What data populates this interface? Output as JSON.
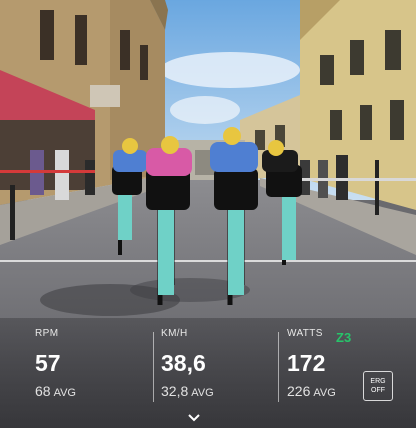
{
  "metrics": {
    "rpm": {
      "label": "RPM",
      "value": "57",
      "avg_value": "68",
      "avg_label": "AVG"
    },
    "speed": {
      "label": "KM/H",
      "value": "38,6",
      "avg_value": "32,8",
      "avg_label": "AVG"
    },
    "power": {
      "label": "WATTS",
      "zone": "Z3",
      "value": "172",
      "avg_value": "226",
      "avg_label": "AVG"
    }
  },
  "erg_toggle": {
    "line1": "ERG",
    "line2": "OFF"
  },
  "colors": {
    "zone": "#27c46a",
    "jersey_blue": "#4f7fd2",
    "jersey_pink": "#d85aa6",
    "bike": "#6fd1c7"
  },
  "icons": {
    "expand": "chevron-down-icon"
  }
}
